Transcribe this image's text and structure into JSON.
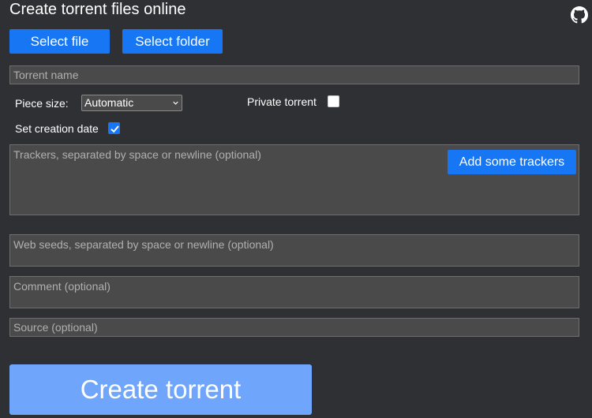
{
  "header": {
    "title": "Create torrent files online",
    "github_icon": "github-icon"
  },
  "actions": {
    "select_file_label": "Select file",
    "select_folder_label": "Select folder"
  },
  "form": {
    "torrent_name_placeholder": "Torrent name",
    "piece_size_label": "Piece size:",
    "piece_size_value": "Automatic",
    "private_torrent_label": "Private torrent",
    "private_torrent_checked": false,
    "creation_date_label": "Set creation date",
    "creation_date_checked": true,
    "trackers_placeholder": "Trackers, separated by space or newline (optional)",
    "add_trackers_label": "Add some trackers",
    "web_seeds_placeholder": "Web seeds, separated by space or newline (optional)",
    "comment_placeholder": "Comment (optional)",
    "source_placeholder": "Source (optional)",
    "create_label": "Create torrent"
  },
  "colors": {
    "background": "#2e3033",
    "primary_button": "#1676f3",
    "create_button_disabled": "#6fa6fb",
    "field_background": "#4a4a4a"
  }
}
